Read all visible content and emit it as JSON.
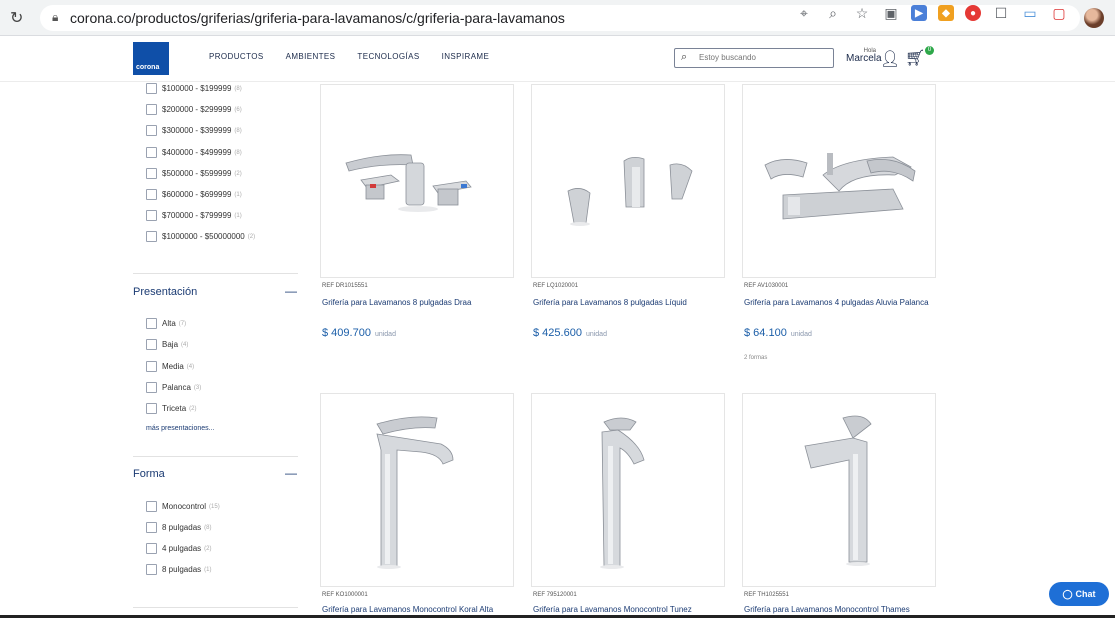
{
  "browser": {
    "url": "corona.co/productos/griferias/griferia-para-lavamanos/c/griferia-para-lavamanos"
  },
  "header": {
    "logo_text": "corona",
    "nav": [
      "PRODUCTOS",
      "AMBIENTES",
      "TECNOLOGÍAS",
      "INSPIRAME"
    ],
    "search_placeholder": "Estoy buscando",
    "greeting": "Hola",
    "user_name": "Marcela",
    "cart_count": "0"
  },
  "filters": {
    "price_ranges": [
      {
        "label": "$100000 - $199999",
        "count": "(8)"
      },
      {
        "label": "$200000 - $299999",
        "count": "(6)"
      },
      {
        "label": "$300000 - $399999",
        "count": "(8)"
      },
      {
        "label": "$400000 - $499999",
        "count": "(8)"
      },
      {
        "label": "$500000 - $599999",
        "count": "(2)"
      },
      {
        "label": "$600000 - $699999",
        "count": "(1)"
      },
      {
        "label": "$700000 - $799999",
        "count": "(1)"
      },
      {
        "label": "$1000000 - $50000000",
        "count": "(2)"
      }
    ],
    "presentacion": {
      "title": "Presentación",
      "items": [
        {
          "label": "Alta",
          "count": "(7)"
        },
        {
          "label": "Baja",
          "count": "(4)"
        },
        {
          "label": "Media",
          "count": "(4)"
        },
        {
          "label": "Palanca",
          "count": "(3)"
        },
        {
          "label": "Triceta",
          "count": "(2)"
        }
      ],
      "more": "más presentaciones..."
    },
    "forma": {
      "title": "Forma",
      "items": [
        {
          "label": "Monocontrol",
          "count": "(15)"
        },
        {
          "label": "8 pulgadas",
          "count": "(8)"
        },
        {
          "label": "4 pulgadas",
          "count": "(2)"
        },
        {
          "label": "8 pulgadas",
          "count": "(1)"
        }
      ]
    }
  },
  "products": [
    {
      "ref": "REF DR1015551",
      "name": "Grifería para Lavamanos 8 pulgadas Draa",
      "price": "$ 409.700",
      "unit": "unidad"
    },
    {
      "ref": "REF LQ1020001",
      "name": "Grifería para Lavamanos 8 pulgadas Líquid",
      "price": "$ 425.600",
      "unit": "unidad"
    },
    {
      "ref": "REF AV1030001",
      "name": "Grifería para Lavamanos 4 pulgadas Aluvia Palanca",
      "price": "$ 64.100",
      "unit": "unidad",
      "variants": "2 formas"
    },
    {
      "ref": "REF KO1000001",
      "name": "Grifería para Lavamanos Monocontrol Koral Alta"
    },
    {
      "ref": "REF 795120001",
      "name": "Grifería para Lavamanos Monocontrol Tunez"
    },
    {
      "ref": "REF TH1025551",
      "name": "Grifería para Lavamanos Monocontrol Thames"
    }
  ],
  "chat_label": "Chat"
}
